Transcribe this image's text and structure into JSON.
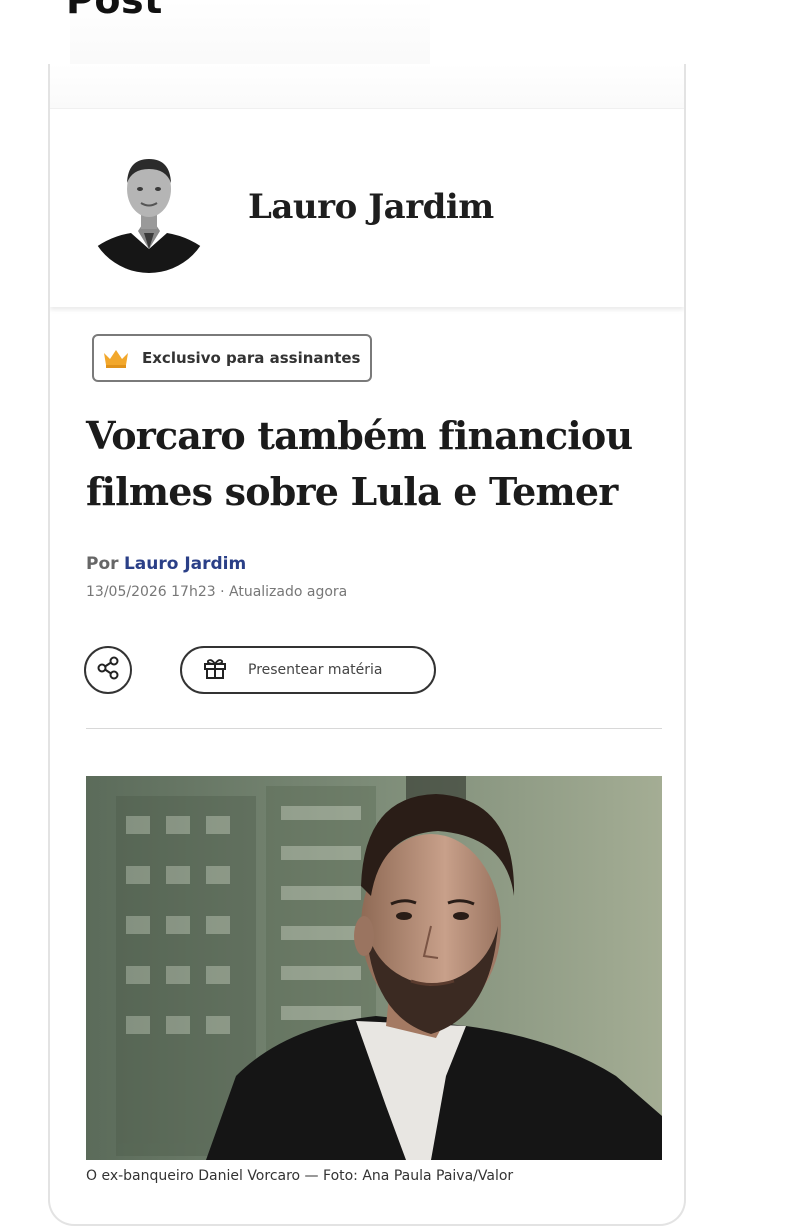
{
  "page": {
    "header_title": "Post"
  },
  "column": {
    "columnist_name": "Lauro Jardim"
  },
  "article": {
    "badge_label": "Exclusivo para assinantes",
    "headline_line1": "Vorcaro também financiou",
    "headline_line2": "filmes sobre Lula e Temer",
    "byline_prefix": "Por",
    "author": "Lauro Jardim",
    "timestamp": "13/05/2026 17h23 · Atualizado agora",
    "gift_label": "Presentear matéria",
    "photo_caption": "O ex-banqueiro Daniel Vorcaro — Foto: Ana Paula Paiva/Valor"
  },
  "icons": {
    "badge": "crown-icon",
    "share": "share-icon",
    "gift": "gift-icon"
  },
  "colors": {
    "author_link": "#2a3f87",
    "crown": "#f2a72b"
  }
}
